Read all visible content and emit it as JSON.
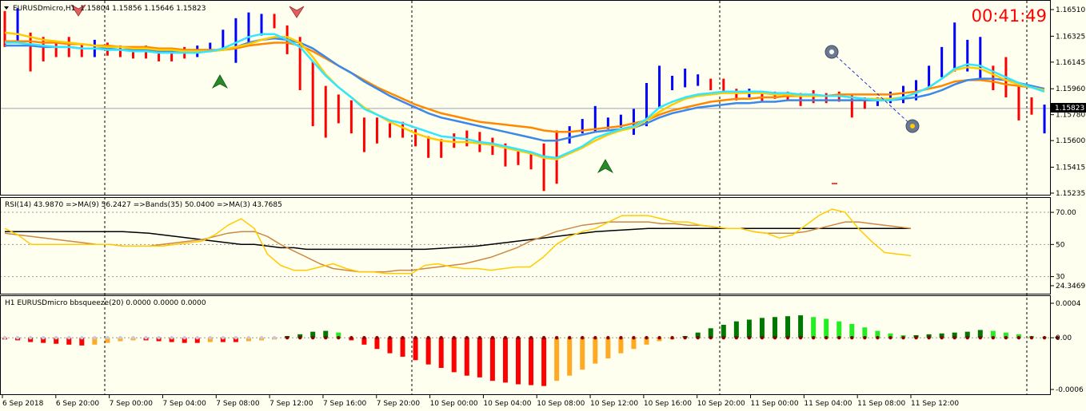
{
  "header": {
    "main_title": "EURUSDmicro,H1",
    "main_ohlc": "1.15804 1.15856 1.15646 1.15823",
    "timer": "00:41:49",
    "current_price_label": "1.15823"
  },
  "price_axis": [
    "1.16510",
    "1.16325",
    "1.16145",
    "1.15960",
    "1.15780",
    "1.15600",
    "1.15415",
    "1.15235"
  ],
  "rsi_panel": {
    "legend": "RSI(14) 43.9870 =>MA(9) 56.2427 =>Bands(35) 50.0400 =>MA(3) 43.7685",
    "axis": [
      "70.00",
      "50",
      "30",
      "24.3469"
    ]
  },
  "bb_panel": {
    "legend": "H1 EURUSDmicro bbsqueeze(20) 0.0000 0.0000 0.0000",
    "axis": [
      "0.0004",
      "0.00",
      "-0.0006"
    ]
  },
  "time_axis": [
    "6 Sep 2018",
    "6 Sep 20:00",
    "7 Sep 00:00",
    "7 Sep 04:00",
    "7 Sep 08:00",
    "7 Sep 12:00",
    "7 Sep 16:00",
    "7 Sep 20:00",
    "10 Sep 00:00",
    "10 Sep 04:00",
    "10 Sep 08:00",
    "10 Sep 12:00",
    "10 Sep 16:00",
    "10 Sep 20:00",
    "11 Sep 00:00",
    "11 Sep 04:00",
    "11 Sep 08:00",
    "11 Sep 12:00"
  ],
  "colors": {
    "bull": "#0000ff",
    "bear": "#ff0000",
    "ma_fast": "#33e6ff",
    "ma_slow": "#3a88e8",
    "ma_yellow": "#ffcc00",
    "ma_orange": "#ff8800",
    "rsi": "#ffcc00",
    "rsi_ma": "#cc8844",
    "rsi_bands": "#000000",
    "bb_green": "#007700",
    "bb_lightgreen": "#22ee22",
    "bb_red": "#ff0000",
    "bb_orange": "#ffaa22"
  },
  "chart_data": [
    {
      "type": "line",
      "title": "EURUSDmicro,H1",
      "ylim": [
        1.15235,
        1.1656
      ],
      "bars": [
        [
          1.1642,
          1.165,
          1.1625,
          1.163
        ],
        [
          1.163,
          1.1652,
          1.1628,
          1.1635
        ],
        [
          1.1632,
          1.1635,
          1.1608,
          1.1612
        ],
        [
          1.1628,
          1.1632,
          1.1615,
          1.1622
        ],
        [
          1.1624,
          1.1628,
          1.1618,
          1.1621
        ],
        [
          1.1624,
          1.1632,
          1.1618,
          1.1623
        ],
        [
          1.1625,
          1.1627,
          1.1618,
          1.1622
        ],
        [
          1.1623,
          1.163,
          1.1618,
          1.1625
        ],
        [
          1.1624,
          1.1628,
          1.1619,
          1.1622
        ],
        [
          1.1622,
          1.1626,
          1.1618,
          1.162
        ],
        [
          1.1622,
          1.1625,
          1.1617,
          1.1618
        ],
        [
          1.1623,
          1.1626,
          1.1617,
          1.1619
        ],
        [
          1.1623,
          1.1624,
          1.1615,
          1.1616
        ],
        [
          1.1621,
          1.1622,
          1.1615,
          1.1616
        ],
        [
          1.1622,
          1.1625,
          1.1617,
          1.1618
        ],
        [
          1.1621,
          1.1626,
          1.1618,
          1.1622
        ],
        [
          1.1624,
          1.1628,
          1.1622,
          1.1627
        ],
        [
          1.1627,
          1.1637,
          1.1624,
          1.1634
        ],
        [
          1.1618,
          1.1645,
          1.1614,
          1.1642
        ],
        [
          1.1635,
          1.1649,
          1.1627,
          1.1646
        ],
        [
          1.1638,
          1.1648,
          1.1633,
          1.1645
        ],
        [
          1.1643,
          1.1648,
          1.1638,
          1.1642
        ],
        [
          1.163,
          1.164,
          1.162,
          1.1626
        ],
        [
          1.1628,
          1.1632,
          1.1595,
          1.16
        ],
        [
          1.161,
          1.1615,
          1.157,
          1.158
        ],
        [
          1.1592,
          1.1598,
          1.1562,
          1.1575
        ],
        [
          1.1588,
          1.1592,
          1.1572,
          1.1578
        ],
        [
          1.1585,
          1.1588,
          1.1565,
          1.157
        ],
        [
          1.1572,
          1.1576,
          1.1552,
          1.1558
        ],
        [
          1.1572,
          1.1576,
          1.1558,
          1.1565
        ],
        [
          1.1568,
          1.1572,
          1.1562,
          1.1565
        ],
        [
          1.157,
          1.1573,
          1.1562,
          1.1567
        ],
        [
          1.1565,
          1.1568,
          1.1556,
          1.1559
        ],
        [
          1.156,
          1.1563,
          1.1548,
          1.1552
        ],
        [
          1.1558,
          1.1561,
          1.1548,
          1.1552
        ],
        [
          1.1562,
          1.1565,
          1.1555,
          1.1558
        ],
        [
          1.1565,
          1.1567,
          1.1556,
          1.156
        ],
        [
          1.1563,
          1.1566,
          1.1552,
          1.1556
        ],
        [
          1.156,
          1.1562,
          1.155,
          1.1553
        ],
        [
          1.1555,
          1.1558,
          1.1542,
          1.1546
        ],
        [
          1.155,
          1.1553,
          1.1543,
          1.1546
        ],
        [
          1.1548,
          1.1552,
          1.154,
          1.1544
        ],
        [
          1.1556,
          1.1558,
          1.1525,
          1.153
        ],
        [
          1.1565,
          1.1567,
          1.153,
          1.1535
        ],
        [
          1.156,
          1.157,
          1.1558,
          1.1567
        ],
        [
          1.1567,
          1.1575,
          1.1565,
          1.1573
        ],
        [
          1.1568,
          1.1584,
          1.1566,
          1.158
        ],
        [
          1.157,
          1.1576,
          1.1568,
          1.1573
        ],
        [
          1.157,
          1.1578,
          1.1569,
          1.1575
        ],
        [
          1.1565,
          1.1582,
          1.1564,
          1.1578
        ],
        [
          1.1572,
          1.16,
          1.157,
          1.1595
        ],
        [
          1.1585,
          1.1612,
          1.1583,
          1.1607
        ],
        [
          1.16,
          1.1605,
          1.1595,
          1.1602
        ],
        [
          1.16,
          1.161,
          1.1597,
          1.1608
        ],
        [
          1.1602,
          1.1606,
          1.1598,
          1.1603
        ],
        [
          1.1602,
          1.1603,
          1.1595,
          1.1597
        ],
        [
          1.1602,
          1.1603,
          1.1594,
          1.1595
        ],
        [
          1.1594,
          1.1596,
          1.1588,
          1.159
        ],
        [
          1.1592,
          1.1596,
          1.159,
          1.1594
        ],
        [
          1.1592,
          1.1594,
          1.1587,
          1.1589
        ],
        [
          1.1592,
          1.1594,
          1.1589,
          1.159
        ],
        [
          1.1593,
          1.1594,
          1.1588,
          1.1589
        ],
        [
          1.1592,
          1.1593,
          1.1584,
          1.1586
        ],
        [
          1.1594,
          1.1595,
          1.1586,
          1.1587
        ],
        [
          1.1592,
          1.1593,
          1.1586,
          1.1588
        ],
        [
          1.1592,
          1.1594,
          1.1587,
          1.1589
        ],
        [
          1.1591,
          1.1592,
          1.1576,
          1.1579
        ],
        [
          1.1588,
          1.159,
          1.1582,
          1.1583
        ],
        [
          1.1586,
          1.159,
          1.1584,
          1.1588
        ],
        [
          1.1588,
          1.1594,
          1.1586,
          1.1593
        ],
        [
          1.1588,
          1.1598,
          1.1586,
          1.1596
        ],
        [
          1.159,
          1.1602,
          1.1588,
          1.16
        ],
        [
          1.1598,
          1.1612,
          1.1596,
          1.161
        ],
        [
          1.1605,
          1.1625,
          1.1604,
          1.1622
        ],
        [
          1.161,
          1.1642,
          1.1608,
          1.162
        ],
        [
          1.1612,
          1.163,
          1.1608,
          1.1618
        ],
        [
          1.1605,
          1.1632,
          1.1603,
          1.163
        ],
        [
          1.1605,
          1.1612,
          1.1595,
          1.1598
        ],
        [
          1.161,
          1.1618,
          1.159,
          1.1592
        ],
        [
          1.1598,
          1.16,
          1.1574,
          1.1578
        ],
        [
          1.1588,
          1.159,
          1.1578,
          1.1582
        ],
        [
          1.158,
          1.1585,
          1.1565,
          1.1582
        ]
      ],
      "ma_fast": [
        1.1628,
        1.1628,
        1.1627,
        1.1626,
        1.1625,
        1.1625,
        1.1624,
        1.1624,
        1.1623,
        1.1623,
        1.1622,
        1.1622,
        1.1621,
        1.1621,
        1.1621,
        1.1621,
        1.1622,
        1.1624,
        1.1628,
        1.1632,
        1.1634,
        1.1634,
        1.163,
        1.1625,
        1.1615,
        1.1605,
        1.1597,
        1.159,
        1.1582,
        1.1578,
        1.1574,
        1.1572,
        1.1569,
        1.1566,
        1.1563,
        1.1562,
        1.1561,
        1.1559,
        1.1558,
        1.1556,
        1.1554,
        1.1552,
        1.1549,
        1.1548,
        1.1552,
        1.1556,
        1.1562,
        1.1565,
        1.1568,
        1.157,
        1.1575,
        1.1583,
        1.1587,
        1.159,
        1.1592,
        1.1593,
        1.1594,
        1.1594,
        1.1594,
        1.1594,
        1.1593,
        1.1593,
        1.1592,
        1.1592,
        1.1591,
        1.1591,
        1.159,
        1.1589,
        1.1588,
        1.1588,
        1.159,
        1.1593,
        1.1597,
        1.1603,
        1.161,
        1.1613,
        1.1612,
        1.1608,
        1.1604,
        1.16,
        1.1597,
        1.1594
      ],
      "ma_slow": [
        1.1626,
        1.1626,
        1.1626,
        1.1625,
        1.1625,
        1.1625,
        1.1624,
        1.1624,
        1.1624,
        1.1623,
        1.1623,
        1.1623,
        1.1622,
        1.1622,
        1.1622,
        1.1622,
        1.1622,
        1.1623,
        1.1625,
        1.1628,
        1.163,
        1.1631,
        1.163,
        1.1628,
        1.1624,
        1.1618,
        1.1612,
        1.1607,
        1.1601,
        1.1596,
        1.1591,
        1.1587,
        1.1583,
        1.1579,
        1.1576,
        1.1574,
        1.1572,
        1.157,
        1.1568,
        1.1566,
        1.1564,
        1.1562,
        1.156,
        1.156,
        1.1562,
        1.1564,
        1.1566,
        1.1567,
        1.1568,
        1.1569,
        1.1572,
        1.1576,
        1.1579,
        1.1581,
        1.1583,
        1.1584,
        1.1585,
        1.1586,
        1.1586,
        1.1587,
        1.1587,
        1.1588,
        1.1588,
        1.1588,
        1.1588,
        1.1588,
        1.1588,
        1.1588,
        1.1588,
        1.1588,
        1.1589,
        1.159,
        1.1592,
        1.1595,
        1.1599,
        1.1602,
        1.1603,
        1.1603,
        1.1602,
        1.16,
        1.1598,
        1.1596
      ],
      "ma_yellow": [
        1.1635,
        1.1634,
        1.1632,
        1.163,
        1.1629,
        1.1628,
        1.1627,
        1.1626,
        1.1625,
        1.1625,
        1.1624,
        1.1624,
        1.1623,
        1.1623,
        1.1622,
        1.1622,
        1.1622,
        1.1623,
        1.1625,
        1.1627,
        1.163,
        1.1632,
        1.1632,
        1.1628,
        1.1618,
        1.1606,
        1.1597,
        1.159,
        1.1583,
        1.1578,
        1.1573,
        1.1569,
        1.1565,
        1.1562,
        1.156,
        1.1559,
        1.1559,
        1.1558,
        1.1557,
        1.1555,
        1.1553,
        1.1551,
        1.1548,
        1.1547,
        1.1551,
        1.1555,
        1.156,
        1.1564,
        1.1567,
        1.1569,
        1.1574,
        1.158,
        1.1585,
        1.1589,
        1.1591,
        1.1592,
        1.1593,
        1.1593,
        1.1593,
        1.1593,
        1.1592,
        1.1592,
        1.1591,
        1.1591,
        1.1591,
        1.1591,
        1.159,
        1.1589,
        1.1589,
        1.1589,
        1.159,
        1.1593,
        1.1597,
        1.1603,
        1.1609,
        1.1611,
        1.161,
        1.1606,
        1.1602,
        1.1599,
        1.1597,
        1.1595
      ],
      "ma_orange": [
        1.1629,
        1.1629,
        1.1629,
        1.1628,
        1.1628,
        1.1627,
        1.1627,
        1.1626,
        1.1626,
        1.1625,
        1.1625,
        1.1625,
        1.1624,
        1.1624,
        1.1623,
        1.1623,
        1.1623,
        1.1623,
        1.1624,
        1.1626,
        1.1627,
        1.1628,
        1.1628,
        1.1626,
        1.1622,
        1.1617,
        1.1612,
        1.1607,
        1.1602,
        1.1597,
        1.1593,
        1.1589,
        1.1585,
        1.1582,
        1.1579,
        1.1577,
        1.1575,
        1.1573,
        1.1572,
        1.1571,
        1.157,
        1.1569,
        1.1567,
        1.1566,
        1.1566,
        1.1567,
        1.1568,
        1.1569,
        1.157,
        1.1572,
        1.1574,
        1.1578,
        1.1581,
        1.1583,
        1.1585,
        1.1587,
        1.1588,
        1.1589,
        1.1589,
        1.159,
        1.159,
        1.1591,
        1.1591,
        1.1591,
        1.1591,
        1.1592,
        1.1592,
        1.1592,
        1.1592,
        1.1592,
        1.1593,
        1.1594,
        1.1596,
        1.1598,
        1.1601,
        1.1602,
        1.1602,
        1.1601,
        1.1599,
        1.1598,
        1.1597,
        1.1596
      ]
    },
    {
      "type": "line",
      "title": "RSI(14) 43.9870 =>MA(9) 56.2427 =>Bands(35) 50.0400 =>MA(3) 43.7685",
      "ylim": [
        24.3469,
        74.0
      ],
      "rsi": [
        60,
        56,
        50,
        50,
        50,
        50,
        50,
        50,
        50,
        49,
        49,
        49,
        49,
        50,
        51,
        52,
        56,
        62,
        66,
        60,
        44,
        37,
        34,
        34,
        36,
        38,
        35,
        33,
        33,
        32,
        32,
        32,
        37,
        38,
        36,
        35,
        35,
        34,
        35,
        36,
        36,
        42,
        50,
        55,
        58,
        60,
        64,
        68,
        68,
        68,
        66,
        64,
        64,
        62,
        61,
        60,
        60,
        58,
        57,
        54,
        56,
        62,
        68,
        72,
        70,
        60,
        52,
        45,
        44,
        43
      ],
      "rsi_ma": [
        57,
        56,
        55,
        54,
        53,
        52,
        51,
        50,
        50,
        49,
        49,
        49,
        50,
        51,
        52,
        53,
        55,
        57,
        58,
        58,
        55,
        50,
        46,
        42,
        38,
        35,
        34,
        33,
        33,
        33,
        34,
        34,
        35,
        36,
        37,
        38,
        40,
        42,
        45,
        48,
        52,
        55,
        58,
        60,
        62,
        63,
        64,
        64,
        64,
        64,
        63,
        63,
        62,
        62,
        61,
        60,
        60,
        58,
        57,
        57,
        57,
        58,
        60,
        62,
        64,
        64,
        63,
        62,
        61,
        60
      ],
      "rsi_bands": [
        58,
        58,
        58,
        58,
        58,
        58,
        58,
        58,
        58,
        58,
        57.5,
        57,
        56,
        55,
        54,
        53,
        52,
        51,
        50,
        50,
        49,
        48,
        48,
        47,
        47,
        47,
        47,
        47,
        47,
        47,
        47,
        47,
        47,
        47.5,
        48,
        48.5,
        49,
        50,
        51,
        52,
        53,
        54,
        55,
        56,
        57,
        58,
        58.5,
        59,
        59.5,
        60,
        60,
        60,
        60,
        60,
        60,
        60,
        60,
        60,
        60,
        60,
        60,
        60,
        60,
        60,
        60,
        60,
        60,
        60,
        60,
        60
      ]
    },
    {
      "type": "bar",
      "title": "H1 EURUSDmicro bbsqueeze(20) 0.0000 0.0000 0.0000",
      "ylim": [
        -0.0006,
        0.0004
      ],
      "values": [
        -2e-05,
        -3e-05,
        -5e-05,
        -6e-05,
        -7e-05,
        -8e-05,
        -9e-05,
        -8e-05,
        -6e-05,
        -4e-05,
        -3e-05,
        -3e-05,
        -4e-05,
        -5e-05,
        -6e-05,
        -6e-05,
        -5e-05,
        -5e-05,
        -5e-05,
        -4e-05,
        -3e-05,
        -2e-05,
        2e-05,
        4e-05,
        7e-05,
        8e-05,
        6e-05,
        -3e-05,
        -8e-05,
        -0.00013,
        -0.00018,
        -0.00022,
        -0.00026,
        -0.00031,
        -0.00035,
        -0.0004,
        -0.00044,
        -0.00046,
        -0.0005,
        -0.00052,
        -0.00054,
        -0.00055,
        -0.00056,
        -0.0005,
        -0.00044,
        -0.00037,
        -0.0003,
        -0.00024,
        -0.00018,
        -0.00013,
        -8e-05,
        -4e-05,
        -2e-05,
        2e-05,
        6e-05,
        0.00011,
        0.00015,
        0.00019,
        0.00021,
        0.00023,
        0.00024,
        0.00025,
        0.00026,
        0.00024,
        0.00022,
        0.00019,
        0.00016,
        0.00012,
        8e-05,
        5e-05,
        3e-05,
        3e-05,
        4e-05,
        5e-05,
        6e-05,
        7e-05,
        9e-05,
        8e-05,
        6e-05,
        4e-05,
        2e-05,
        1e-05,
        1e-05
      ]
    }
  ]
}
